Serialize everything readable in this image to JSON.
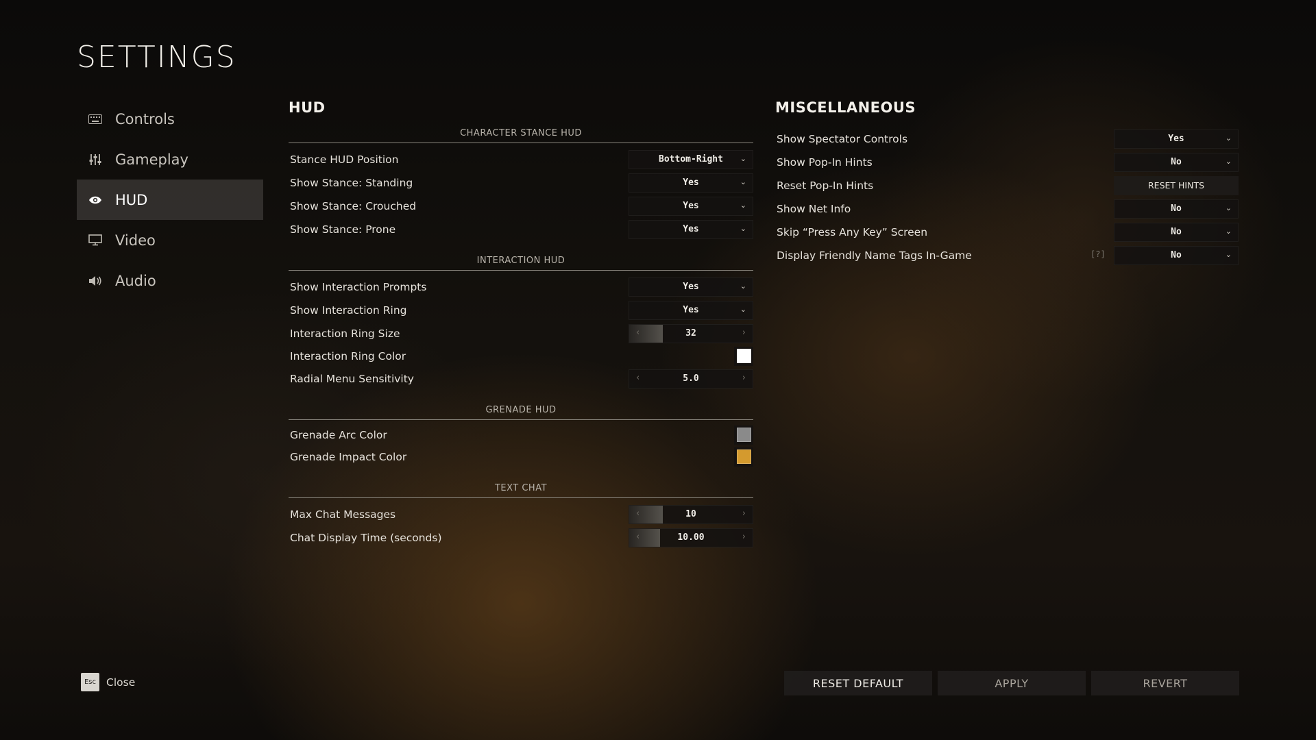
{
  "page_title": "SETTINGS",
  "nav": {
    "items": [
      {
        "label": "Controls",
        "icon": "keyboard-icon"
      },
      {
        "label": "Gameplay",
        "icon": "sliders-icon"
      },
      {
        "label": "HUD",
        "icon": "eye-icon",
        "active": true
      },
      {
        "label": "Video",
        "icon": "monitor-icon"
      },
      {
        "label": "Audio",
        "icon": "speaker-icon"
      }
    ]
  },
  "hud": {
    "heading": "HUD",
    "sections": {
      "stance": {
        "title": "CHARACTER STANCE HUD",
        "rows": [
          {
            "label": "Stance HUD Position",
            "value": "Bottom-Right"
          },
          {
            "label": "Show Stance: Standing",
            "value": "Yes"
          },
          {
            "label": "Show Stance: Crouched",
            "value": "Yes"
          },
          {
            "label": "Show Stance: Prone",
            "value": "Yes"
          }
        ]
      },
      "interaction": {
        "title": "INTERACTION HUD",
        "prompts": {
          "label": "Show Interaction Prompts",
          "value": "Yes"
        },
        "ring": {
          "label": "Show Interaction Ring",
          "value": "Yes"
        },
        "ring_size": {
          "label": "Interaction Ring Size",
          "value": "32",
          "fill_fraction": 0.27
        },
        "ring_color": {
          "label": "Interaction Ring Color",
          "color": "#ffffff"
        },
        "radial": {
          "label": "Radial Menu Sensitivity",
          "value": "5.0",
          "fill_fraction": 0.0
        }
      },
      "grenade": {
        "title": "GRENADE HUD",
        "arc": {
          "label": "Grenade Arc Color",
          "color": "#8a8a8a"
        },
        "impact": {
          "label": "Grenade Impact Color",
          "color": "#d49a2e"
        }
      },
      "chat": {
        "title": "TEXT CHAT",
        "max": {
          "label": "Max Chat Messages",
          "value": "10",
          "fill_fraction": 0.27
        },
        "time": {
          "label": "Chat Display Time (seconds)",
          "value": "10.00",
          "fill_fraction": 0.25
        }
      }
    }
  },
  "misc": {
    "heading": "MISCELLANEOUS",
    "spectator": {
      "label": "Show Spectator Controls",
      "value": "Yes"
    },
    "popin": {
      "label": "Show Pop-In Hints",
      "value": "No"
    },
    "reset": {
      "label": "Reset Pop-In Hints",
      "button": "RESET HINTS"
    },
    "netinfo": {
      "label": "Show Net Info",
      "value": "No"
    },
    "skip": {
      "label": "Skip “Press Any Key” Screen",
      "value": "No"
    },
    "nametags": {
      "label": "Display Friendly Name Tags In-Game",
      "value": "No",
      "help": "[?]"
    }
  },
  "footer": {
    "esc_key": "Esc",
    "close_label": "Close",
    "reset_default": "RESET DEFAULT",
    "apply": "APPLY",
    "revert": "REVERT"
  },
  "colors": {
    "accent_active_nav": "#3c3a37",
    "button_text_dim": "#a9a49c"
  }
}
